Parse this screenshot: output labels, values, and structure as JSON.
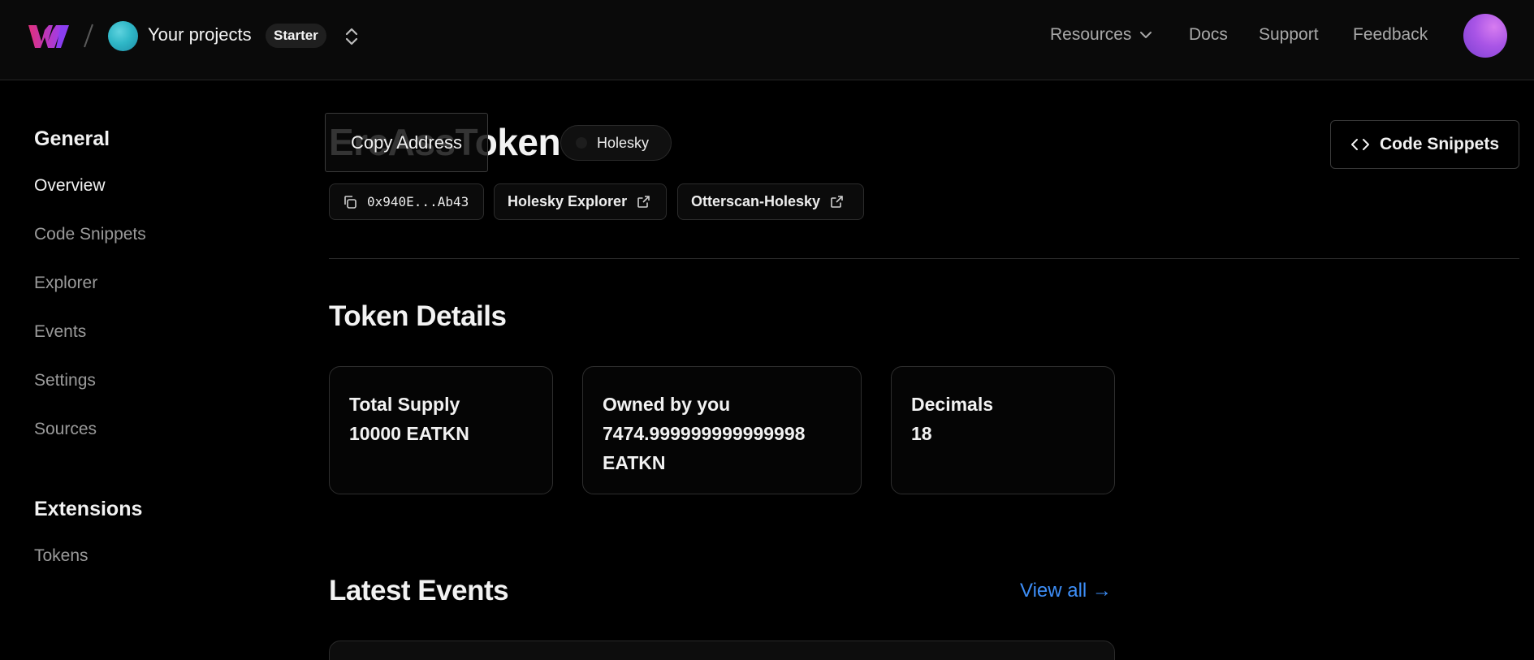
{
  "header": {
    "logo_icon": "brand-w-logo",
    "project_name": "Your projects",
    "plan_badge": "Starter",
    "nav": {
      "resources": "Resources",
      "docs": "Docs",
      "support": "Support",
      "feedback": "Feedback"
    }
  },
  "sidebar": {
    "general_heading": "General",
    "items": [
      {
        "label": "Overview",
        "active": true
      },
      {
        "label": "Code Snippets",
        "active": false
      },
      {
        "label": "Explorer",
        "active": false
      },
      {
        "label": "Events",
        "active": false
      },
      {
        "label": "Settings",
        "active": false
      },
      {
        "label": "Sources",
        "active": false
      }
    ],
    "extensions_heading": "Extensions",
    "extensions_items": [
      {
        "label": "Tokens"
      }
    ]
  },
  "token": {
    "title": "ErcAssToken",
    "network": "Holesky",
    "address_short": "0x940E...Ab43",
    "tooltip": "Copy Address",
    "links": [
      {
        "label": "Holesky Explorer"
      },
      {
        "label": "Otterscan-Holesky"
      }
    ],
    "code_snippets_button": "Code Snippets"
  },
  "token_details": {
    "title": "Token Details",
    "cards": [
      {
        "label": "Total Supply",
        "value": "10000 EATKN"
      },
      {
        "label": "Owned by you",
        "value": "7474.999999999999998 EATKN"
      },
      {
        "label": "Decimals",
        "value": "18"
      }
    ]
  },
  "latest_events": {
    "title": "Latest Events",
    "view_all": "View all →"
  },
  "colors": {
    "background": "#000000",
    "header_bg": "#0a0a0a",
    "link_blue": "#3d8ef7",
    "muted_text": "#9a9a9a"
  }
}
